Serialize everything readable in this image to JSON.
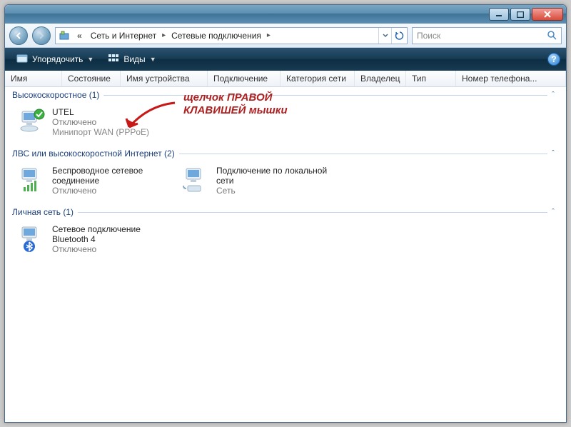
{
  "breadcrumb": {
    "prefix": "«",
    "seg1": "Сеть и Интернет",
    "seg2": "Сетевые подключения"
  },
  "search": {
    "placeholder": "Поиск"
  },
  "toolbar": {
    "organize": "Упорядочить",
    "views": "Виды"
  },
  "columns": {
    "c1": "Имя",
    "c2": "Состояние",
    "c3": "Имя устройства",
    "c4": "Подключение",
    "c5": "Категория сети",
    "c6": "Владелец",
    "c7": "Тип",
    "c8": "Номер телефона..."
  },
  "groups": {
    "g1": {
      "title": "Высокоскоростное (1)"
    },
    "g2": {
      "title": "ЛВС или высокоскоростной Интернет (2)"
    },
    "g3": {
      "title": "Личная сеть (1)"
    }
  },
  "items": {
    "utel": {
      "name": "UTEL",
      "l2": "Отключено",
      "l3": "Минипорт WAN (PPPoE)"
    },
    "wifi": {
      "name": "Беспроводное сетевое соединение",
      "l2": "Отключено",
      "l3": ""
    },
    "lan": {
      "name": "Подключение по локальной сети",
      "l2": "Сеть",
      "l3": ""
    },
    "bt": {
      "name": "Сетевое подключение Bluetooth 4",
      "l2": "Отключено",
      "l3": ""
    }
  },
  "annotation": {
    "line1": "щелчок  ПРАВОЙ",
    "line2": "КЛАВИШЕЙ  мышки"
  }
}
